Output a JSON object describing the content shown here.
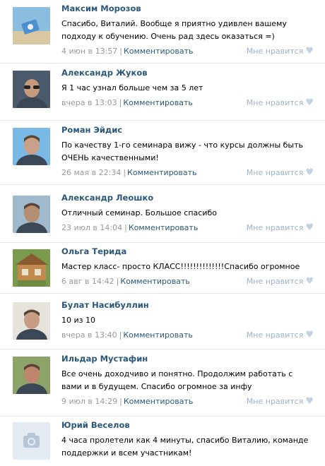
{
  "comments": [
    {
      "author": "Максим Морозов",
      "text": "Спасибо, Виталий. Вообще я приятно удивлен вашему подходу к обучению. Очень рад здесь оказаться =)",
      "date": "4 июн в 13:57",
      "reply": "Комментировать",
      "like": "Мне нравится",
      "avatar": "beach-photo",
      "colors": [
        "#8bbddf",
        "#d8c7a0"
      ]
    },
    {
      "author": "Александр Жуков",
      "text": "Я 1 час узнал больше чем за 5 лет",
      "date": "вчера в 13:03",
      "reply": "Комментировать",
      "like": "Мне нравится",
      "avatar": "man-sunglasses-photo",
      "colors": [
        "#4b5a6a",
        "#c79a7d"
      ]
    },
    {
      "author": "Роман Эйдис",
      "text": "По качеству 1-го семинара вижу - что курсы должны быть ОЧЕНЬ качественными!",
      "date": "26 мая в 22:34",
      "reply": "Комментировать",
      "like": "Мне нравится",
      "avatar": "man-sky-photo",
      "colors": [
        "#7ab8e6",
        "#caa088"
      ]
    },
    {
      "author": "Александр Леошко",
      "text": "Отличный семинар. Большое спасибо",
      "date": "23 июл в 14:04",
      "reply": "Комментировать",
      "like": "Мне нравится",
      "avatar": "man-mosque-photo",
      "colors": [
        "#9fb9cc",
        "#b58e72"
      ]
    },
    {
      "author": "Ольга Терида",
      "text": "Мастер класс- просто КЛАСС!!!!!!!!!!!!!!Спасибо огромное",
      "date": "6 авг в 14:42",
      "reply": "Комментировать",
      "like": "Мне нравится",
      "avatar": "wooden-house-photo",
      "colors": [
        "#c28a4f",
        "#7a9a4d"
      ]
    },
    {
      "author": "Булат Насибуллин",
      "text": "10 из 10",
      "date": "вчера в 13:40",
      "reply": "Комментировать",
      "like": "Мне нравится",
      "avatar": "man-portrait-photo",
      "colors": [
        "#e6e3dc",
        "#c79e83"
      ]
    },
    {
      "author": "Ильдар Мустафин",
      "text": "Все очень доходчиво и понятно. Продолжим работать с вами и в будущем. Спасибо огромное за инфу",
      "date": "9 июл в 14:29",
      "reply": "Комментировать",
      "like": "Мне нравится",
      "avatar": "man-outdoor-photo",
      "colors": [
        "#8ea36a",
        "#c0866d"
      ]
    },
    {
      "author": "Юрий Веселов",
      "text": "4 часа пролетели как 4 минуты, спасибо Виталию, команде поддержки и всем участникам!",
      "date": "",
      "reply": "",
      "like": "",
      "avatar": "camera-placeholder-icon",
      "colors": [
        "#e4ebf2",
        "#b7c6d6"
      ]
    }
  ]
}
